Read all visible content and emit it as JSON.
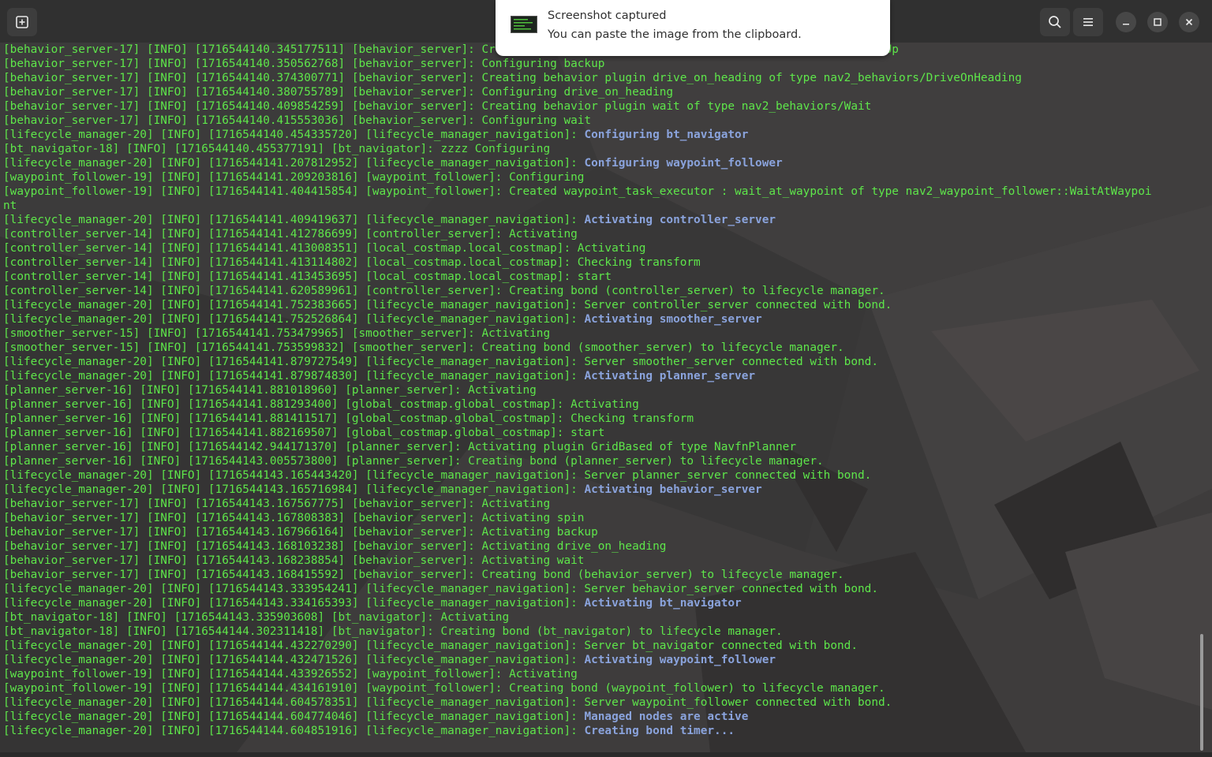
{
  "colors": {
    "log_text": "#5ee64a",
    "highlight_text": "#8aa3dc",
    "titlebar": "#303030",
    "background": "#3a3939"
  },
  "titlebar": {
    "new_tab_icon": "new-tab-icon",
    "search_icon": "search-icon",
    "menu_icon": "hamburger-menu-icon",
    "minimize_icon": "minimize-icon",
    "maximize_icon": "maximize-icon",
    "close_icon": "close-icon"
  },
  "notification": {
    "title": "Screenshot captured",
    "body": "You can paste the image from the clipboard.",
    "icon": "screenshot-thumbnail-icon"
  },
  "terminal": {
    "lines": [
      {
        "text": "[behavior_server-17] [INFO] [1716544140.345177511] [behavior_server]: Creating behavior plugin backup of type nav2_behaviors/BackUp"
      },
      {
        "text": "[behavior_server-17] [INFO] [1716544140.350562768] [behavior_server]: Configuring backup"
      },
      {
        "text": "[behavior_server-17] [INFO] [1716544140.374300771] [behavior_server]: Creating behavior plugin drive_on_heading of type nav2_behaviors/DriveOnHeading"
      },
      {
        "text": "[behavior_server-17] [INFO] [1716544140.380755789] [behavior_server]: Configuring drive_on_heading"
      },
      {
        "text": "[behavior_server-17] [INFO] [1716544140.409854259] [behavior_server]: Creating behavior plugin wait of type nav2_behaviors/Wait"
      },
      {
        "text": "[behavior_server-17] [INFO] [1716544140.415553036] [behavior_server]: Configuring wait"
      },
      {
        "text": "[lifecycle_manager-20] [INFO] [1716544140.454335720] [lifecycle_manager_navigation]: ",
        "hl": "Configuring bt_navigator"
      },
      {
        "text": "[bt_navigator-18] [INFO] [1716544140.455377191] [bt_navigator]: zzzz Configuring"
      },
      {
        "text": "[lifecycle_manager-20] [INFO] [1716544141.207812952] [lifecycle_manager_navigation]: ",
        "hl": "Configuring waypoint_follower"
      },
      {
        "text": "[waypoint_follower-19] [INFO] [1716544141.209203816] [waypoint_follower]: Configuring"
      },
      {
        "text": "[waypoint_follower-19] [INFO] [1716544141.404415854] [waypoint_follower]: Created waypoint_task_executor : wait_at_waypoint of type nav2_waypoint_follower::WaitAtWaypoi"
      },
      {
        "text": "nt"
      },
      {
        "text": "[lifecycle_manager-20] [INFO] [1716544141.409419637] [lifecycle_manager_navigation]: ",
        "hl": "Activating controller_server"
      },
      {
        "text": "[controller_server-14] [INFO] [1716544141.412786699] [controller_server]: Activating"
      },
      {
        "text": "[controller_server-14] [INFO] [1716544141.413008351] [local_costmap.local_costmap]: Activating"
      },
      {
        "text": "[controller_server-14] [INFO] [1716544141.413114802] [local_costmap.local_costmap]: Checking transform"
      },
      {
        "text": "[controller_server-14] [INFO] [1716544141.413453695] [local_costmap.local_costmap]: start"
      },
      {
        "text": "[controller_server-14] [INFO] [1716544141.620589961] [controller_server]: Creating bond (controller_server) to lifecycle manager."
      },
      {
        "text": "[lifecycle_manager-20] [INFO] [1716544141.752383665] [lifecycle_manager_navigation]: Server controller_server connected with bond."
      },
      {
        "text": "[lifecycle_manager-20] [INFO] [1716544141.752526864] [lifecycle_manager_navigation]: ",
        "hl": "Activating smoother_server"
      },
      {
        "text": "[smoother_server-15] [INFO] [1716544141.753479965] [smoother_server]: Activating"
      },
      {
        "text": "[smoother_server-15] [INFO] [1716544141.753599832] [smoother_server]: Creating bond (smoother_server) to lifecycle manager."
      },
      {
        "text": "[lifecycle_manager-20] [INFO] [1716544141.879727549] [lifecycle_manager_navigation]: Server smoother_server connected with bond."
      },
      {
        "text": "[lifecycle_manager-20] [INFO] [1716544141.879874830] [lifecycle_manager_navigation]: ",
        "hl": "Activating planner_server"
      },
      {
        "text": "[planner_server-16] [INFO] [1716544141.881018960] [planner_server]: Activating"
      },
      {
        "text": "[planner_server-16] [INFO] [1716544141.881293400] [global_costmap.global_costmap]: Activating"
      },
      {
        "text": "[planner_server-16] [INFO] [1716544141.881411517] [global_costmap.global_costmap]: Checking transform"
      },
      {
        "text": "[planner_server-16] [INFO] [1716544141.882169507] [global_costmap.global_costmap]: start"
      },
      {
        "text": "[planner_server-16] [INFO] [1716544142.944171370] [planner_server]: Activating plugin GridBased of type NavfnPlanner"
      },
      {
        "text": "[planner_server-16] [INFO] [1716544143.005573800] [planner_server]: Creating bond (planner_server) to lifecycle manager."
      },
      {
        "text": "[lifecycle_manager-20] [INFO] [1716544143.165443420] [lifecycle_manager_navigation]: Server planner_server connected with bond."
      },
      {
        "text": "[lifecycle_manager-20] [INFO] [1716544143.165716984] [lifecycle_manager_navigation]: ",
        "hl": "Activating behavior_server"
      },
      {
        "text": "[behavior_server-17] [INFO] [1716544143.167567775] [behavior_server]: Activating"
      },
      {
        "text": "[behavior_server-17] [INFO] [1716544143.167808383] [behavior_server]: Activating spin"
      },
      {
        "text": "[behavior_server-17] [INFO] [1716544143.167966164] [behavior_server]: Activating backup"
      },
      {
        "text": "[behavior_server-17] [INFO] [1716544143.168103238] [behavior_server]: Activating drive_on_heading"
      },
      {
        "text": "[behavior_server-17] [INFO] [1716544143.168238854] [behavior_server]: Activating wait"
      },
      {
        "text": "[behavior_server-17] [INFO] [1716544143.168415592] [behavior_server]: Creating bond (behavior_server) to lifecycle manager."
      },
      {
        "text": "[lifecycle_manager-20] [INFO] [1716544143.333954241] [lifecycle_manager_navigation]: Server behavior_server connected with bond."
      },
      {
        "text": "[lifecycle_manager-20] [INFO] [1716544143.334165393] [lifecycle_manager_navigation]: ",
        "hl": "Activating bt_navigator"
      },
      {
        "text": "[bt_navigator-18] [INFO] [1716544143.335903608] [bt_navigator]: Activating"
      },
      {
        "text": "[bt_navigator-18] [INFO] [1716544144.302311418] [bt_navigator]: Creating bond (bt_navigator) to lifecycle manager."
      },
      {
        "text": "[lifecycle_manager-20] [INFO] [1716544144.432270290] [lifecycle_manager_navigation]: Server bt_navigator connected with bond."
      },
      {
        "text": "[lifecycle_manager-20] [INFO] [1716544144.432471526] [lifecycle_manager_navigation]: ",
        "hl": "Activating waypoint_follower"
      },
      {
        "text": "[waypoint_follower-19] [INFO] [1716544144.433926552] [waypoint_follower]: Activating"
      },
      {
        "text": "[waypoint_follower-19] [INFO] [1716544144.434161910] [waypoint_follower]: Creating bond (waypoint_follower) to lifecycle manager."
      },
      {
        "text": "[lifecycle_manager-20] [INFO] [1716544144.604578351] [lifecycle_manager_navigation]: Server waypoint_follower connected with bond."
      },
      {
        "text": "[lifecycle_manager-20] [INFO] [1716544144.604774046] [lifecycle_manager_navigation]: ",
        "hl": "Managed nodes are active"
      },
      {
        "text": "[lifecycle_manager-20] [INFO] [1716544144.604851916] [lifecycle_manager_navigation]: ",
        "hl": "Creating bond timer..."
      }
    ]
  }
}
